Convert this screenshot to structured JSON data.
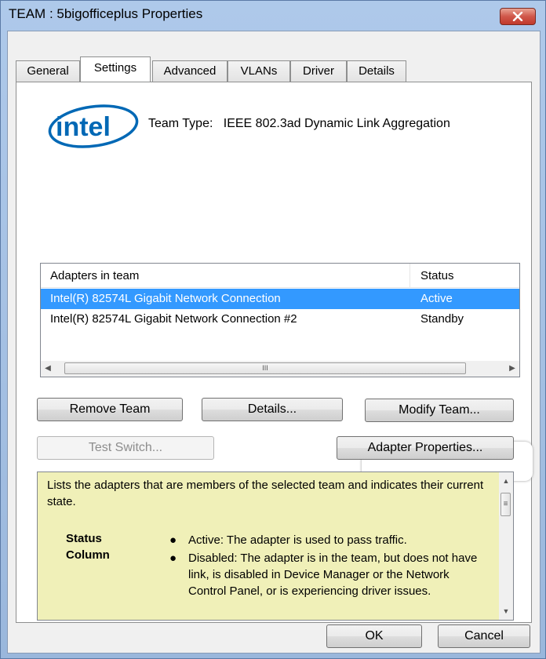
{
  "window": {
    "title": "TEAM : 5bigofficeplus Properties"
  },
  "tabs": [
    {
      "label": "General"
    },
    {
      "label": "Settings"
    },
    {
      "label": "Advanced"
    },
    {
      "label": "VLANs"
    },
    {
      "label": "Driver"
    },
    {
      "label": "Details"
    }
  ],
  "active_tab": "Settings",
  "logo": {
    "text": "intel"
  },
  "team_type": {
    "label": "Team Type:",
    "value": "IEEE 802.3ad Dynamic Link Aggregation"
  },
  "adapters": {
    "columns": [
      "Adapters in team",
      "Status"
    ],
    "rows": [
      {
        "name": "Intel(R) 82574L Gigabit Network Connection",
        "status": "Active",
        "selected": true
      },
      {
        "name": "Intel(R) 82574L Gigabit Network Connection #2",
        "status": "Standby",
        "selected": false
      }
    ],
    "scroll_grip": "III"
  },
  "buttons": {
    "remove_team": "Remove Team",
    "details": "Details...",
    "modify_team": "Modify Team...",
    "test_switch": "Test Switch...",
    "adapter_properties": "Adapter Properties...",
    "ok": "OK",
    "cancel": "Cancel"
  },
  "help": {
    "intro": "Lists the adapters that are members of the selected team and indicates their current state.",
    "label": "Status Column",
    "bullets": [
      "Active: The adapter is used to pass traffic.",
      "Disabled: The adapter is in the team, but does not have link, is disabled in Device Manager or the Network Control Panel, or is experiencing driver issues."
    ]
  },
  "colors": {
    "selection": "#3399ff",
    "help_background": "#f0f0b8",
    "close_button": "#c13a2c"
  }
}
